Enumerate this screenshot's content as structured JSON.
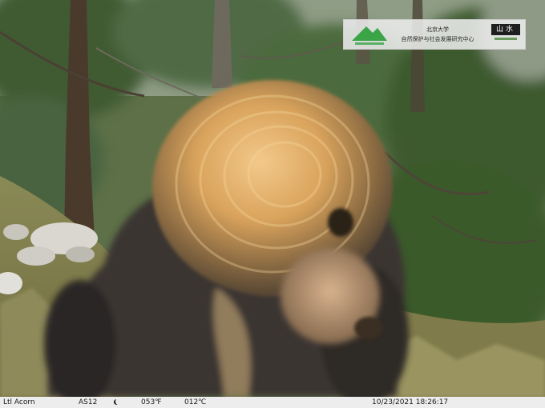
{
  "camera_overlay": {
    "logo_line1": "北京大学",
    "logo_line2": "自然保护与社会发展研究中心",
    "partner_logo_text": "山水",
    "camera_name": "Ltl Acorn",
    "camera_id": "AS12",
    "moon_phase_icon": "waning-crescent-moon-icon",
    "temp_f": "053℉",
    "temp_c": "012℃",
    "datetime": "10/23/2021 18:26:17"
  },
  "scene": {
    "subject": "bear",
    "setting": "forested hillside with juniper trees and rocky slope"
  }
}
